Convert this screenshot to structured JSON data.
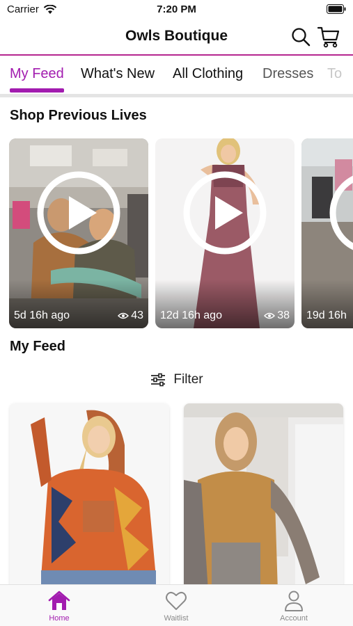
{
  "status_bar": {
    "carrier": "Carrier",
    "time": "7:20 PM"
  },
  "header": {
    "title": "Owls Boutique",
    "search_icon": "search-icon",
    "cart_icon": "cart-icon"
  },
  "tabs": [
    {
      "label": "My Feed",
      "active": true
    },
    {
      "label": "What's New"
    },
    {
      "label": "All Clothing"
    },
    {
      "label": "Dresses"
    },
    {
      "label": "To"
    }
  ],
  "previous_lives": {
    "title": "Shop Previous Lives",
    "items": [
      {
        "time": "5d 16h ago",
        "views": "43"
      },
      {
        "time": "12d 16h ago",
        "views": "38"
      },
      {
        "time": "19d 16h",
        "views": ""
      }
    ]
  },
  "feed": {
    "title": "My Feed",
    "filter_label": "Filter"
  },
  "bottom_nav": [
    {
      "label": "Home",
      "icon": "home-icon",
      "active": true
    },
    {
      "label": "Waitlist",
      "icon": "heart-icon"
    },
    {
      "label": "Account",
      "icon": "person-icon"
    }
  ],
  "colors": {
    "accent": "#a21caf",
    "divider": "#b5268f",
    "tab_inactive": "#111111"
  }
}
